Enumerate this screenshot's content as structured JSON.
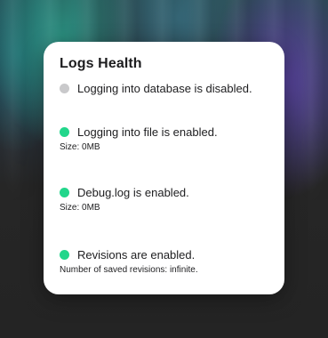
{
  "colors": {
    "enabled": "#22d68b",
    "disabled": "#c9c9cb"
  },
  "card": {
    "title": "Logs Health",
    "items": [
      {
        "status": "disabled",
        "icon": "status-dot-icon",
        "label": "Logging into database is disabled.",
        "detail": ""
      },
      {
        "status": "enabled",
        "icon": "status-dot-icon",
        "label": "Logging into file is enabled.",
        "detail": "Size: 0MB"
      },
      {
        "status": "enabled",
        "icon": "status-dot-icon",
        "label": "Debug.log is enabled.",
        "detail": "Size: 0MB"
      },
      {
        "status": "enabled",
        "icon": "status-dot-icon",
        "label": "Revisions are enabled.",
        "detail": "Number of saved revisions: infinite."
      }
    ]
  }
}
